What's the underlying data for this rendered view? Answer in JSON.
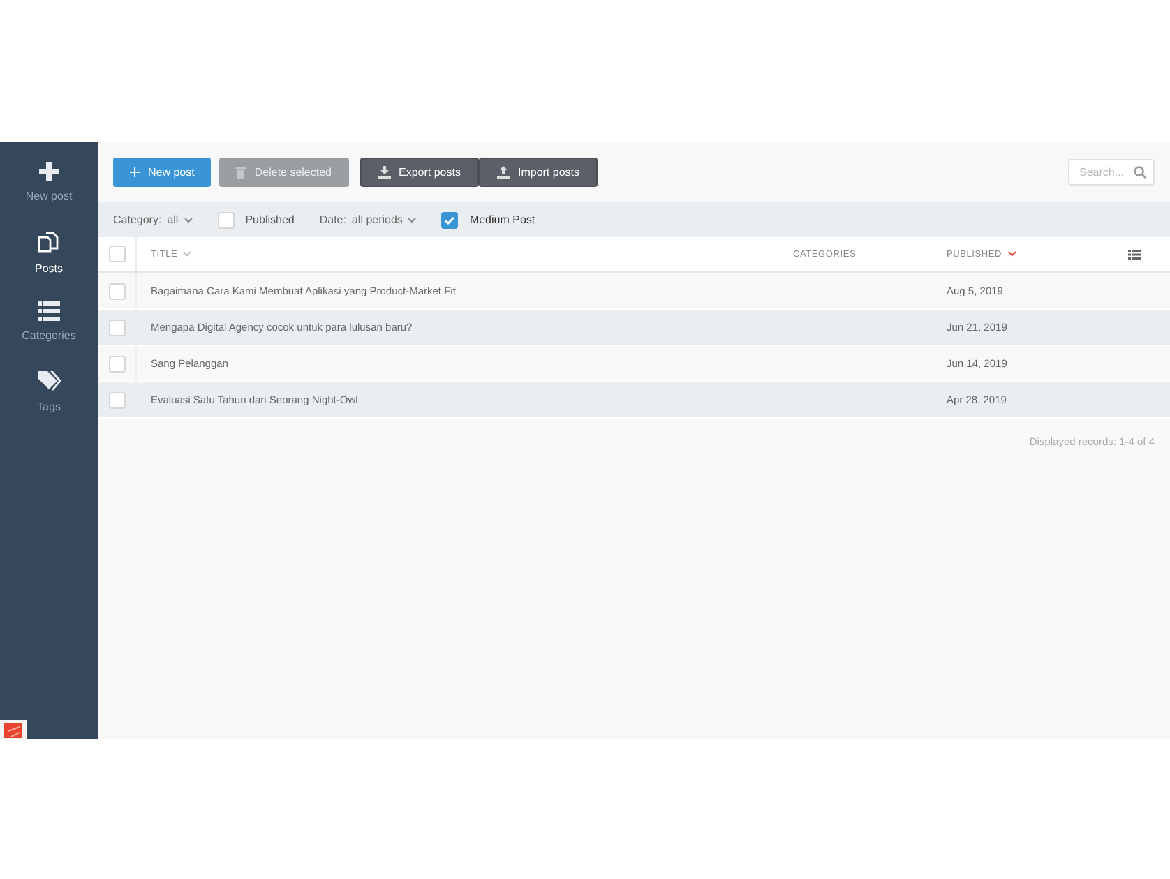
{
  "sidebar": {
    "items": [
      {
        "label": "New post",
        "kind": "plus",
        "selected": false
      },
      {
        "label": "Posts",
        "kind": "posts",
        "selected": true
      },
      {
        "label": "Categories",
        "kind": "list",
        "selected": false
      },
      {
        "label": "Tags",
        "kind": "tag",
        "selected": false
      }
    ]
  },
  "toolbar": {
    "buttons": [
      {
        "label": "New post",
        "kind": "primary",
        "disabled": false
      },
      {
        "label": "Delete selected",
        "kind": "danger",
        "disabled": true
      },
      {
        "label": "Export posts",
        "kind": "export",
        "disabled": false
      },
      {
        "label": "Import posts",
        "kind": "import",
        "disabled": false
      }
    ],
    "search": {
      "placeholder": "Search..."
    }
  },
  "filters": [
    {
      "kind": "dropdown",
      "label": "Category:",
      "value": "all"
    },
    {
      "kind": "checkbox",
      "label": "Published",
      "checked": false
    },
    {
      "kind": "dropdown",
      "label": "Date:",
      "value": "all periods"
    },
    {
      "kind": "checkbox",
      "label": "Medium Post",
      "checked": true
    }
  ],
  "table": {
    "all_checked": false,
    "columns": [
      {
        "label": "TITLE",
        "sorted": false
      },
      {
        "label": "CATEGORIES"
      },
      {
        "label": "PUBLISHED",
        "sorted": true
      }
    ],
    "rows": [
      {
        "title": "Bagaimana Cara Kami Membuat Aplikasi yang Product-Market Fit",
        "published": "Aug 5, 2019",
        "checked": false
      },
      {
        "title": "Mengapa Digital Agency cocok untuk para lulusan baru?",
        "published": "Jun 21, 2019",
        "checked": false
      },
      {
        "title": "Sang Pelanggan",
        "published": "Jun 14, 2019",
        "checked": false
      },
      {
        "title": "Evaluasi Satu Tahun dari Seorang Night-Owl",
        "published": "Apr 28, 2019",
        "checked": false
      }
    ],
    "footer": "Displayed records: 1-4 of 4"
  }
}
